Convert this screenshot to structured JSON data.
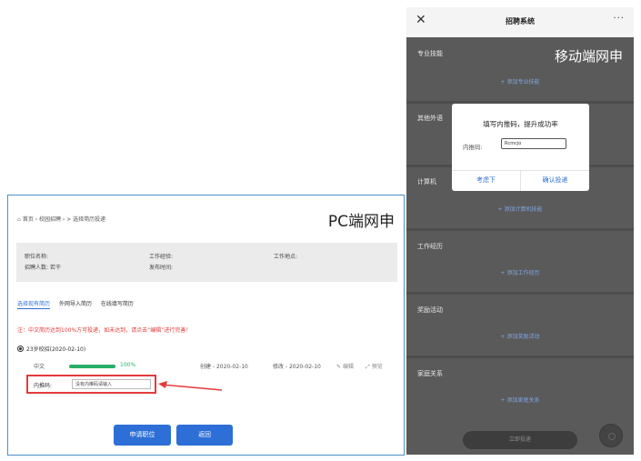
{
  "pc": {
    "label": "PC端网申",
    "breadcrumb": "首页 › 校园招聘 › > 选择简历投递",
    "info": {
      "position": "职位名称:",
      "count_label": "招聘人数:",
      "count_value": "若干",
      "experience": "工作经验:",
      "publish_time": "发布时间:",
      "location": "工作地点:"
    },
    "tabs": [
      "选择现有简历",
      "外网导入简历",
      "在线填写简历"
    ],
    "notice": "注：中文简历达到100%方可投递，如未达到，请点击“编辑”进行完善！",
    "resume": {
      "name": "23岁校招(2020-02-10)",
      "language": "中文",
      "progress_pct": 100,
      "progress_text": "100%",
      "created": "创建 - 2020-02-10",
      "modified": "修改 - 2020-02-10",
      "edit": "编辑",
      "preview": "预览"
    },
    "referral": {
      "label": "内推码:",
      "placeholder": "没有内推码请输入"
    },
    "buttons": {
      "apply": "申请职位",
      "back": "返回"
    }
  },
  "mobile": {
    "label": "移动端网申",
    "title": "招聘系统",
    "close_icon": "close-icon",
    "more_icon": "more-icon",
    "sections": [
      {
        "title": "专业技能",
        "add": "+ 添加专业技能"
      },
      {
        "title": "其他外语",
        "add": ""
      },
      {
        "title": "计算机",
        "add": "+ 添加计算机技能"
      },
      {
        "title": "工作经历",
        "add": "+ 添加工作经历"
      },
      {
        "title": "奖励活动",
        "add": "+ 添加奖励活动"
      },
      {
        "title": "家庭关系",
        "add": "+ 添加家庭关系"
      }
    ],
    "dialog": {
      "title": "填写内推码，提升成功率",
      "label": "内推码:",
      "value": "Rcmcjo",
      "later": "考虑下",
      "confirm": "确认投递"
    },
    "submit": "立即投递"
  }
}
